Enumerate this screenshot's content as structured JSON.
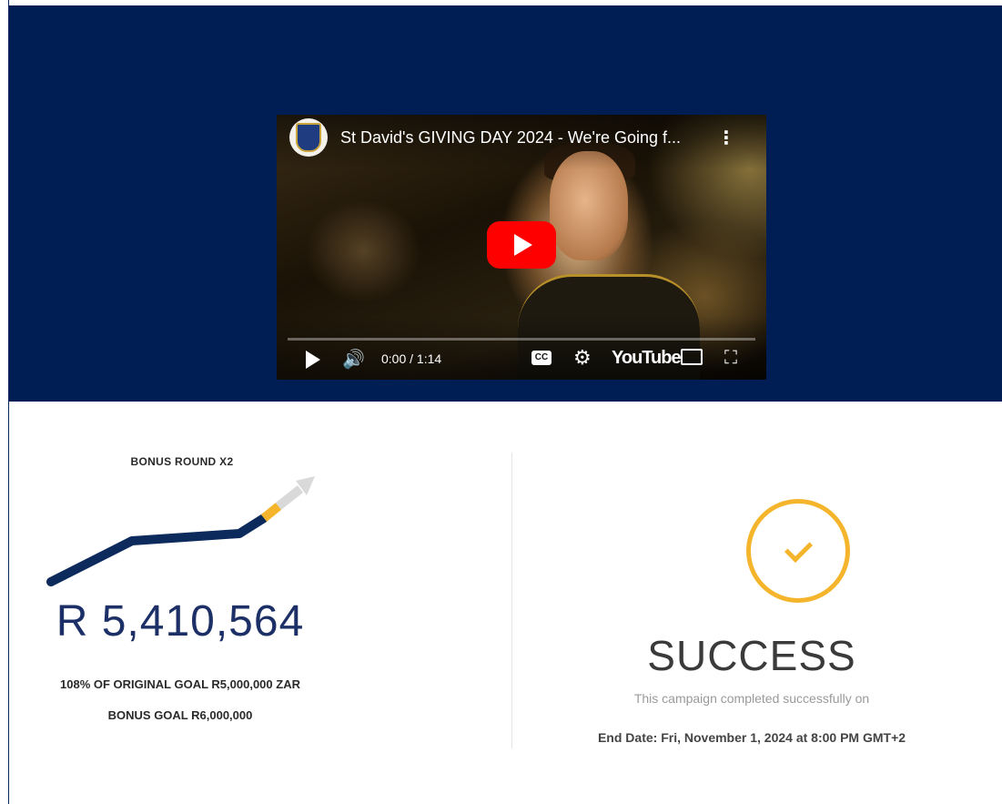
{
  "video": {
    "title": "St David's GIVING DAY 2024 - We're Going f...",
    "time": "0:00 / 1:14",
    "menu_icon": "more-vert-icon",
    "cc_label": "CC",
    "youtube_label": "YouTube"
  },
  "campaign": {
    "bonus_label": "BONUS ROUND X2",
    "amount": "R 5,410,564",
    "original_goal": "108% OF ORIGINAL GOAL R5,000,000 ZAR",
    "bonus_goal": "BONUS GOAL R6,000,000",
    "progress_percent": 108,
    "colors": {
      "navy": "#0d2a5c",
      "gold": "#f4b52c",
      "arrow": "#d9d9d9"
    }
  },
  "status": {
    "title": "SUCCESS",
    "message": "This campaign completed successfully on",
    "end_date": "End Date: Fri, November 1, 2024 at 8:00 PM GMT+2"
  }
}
